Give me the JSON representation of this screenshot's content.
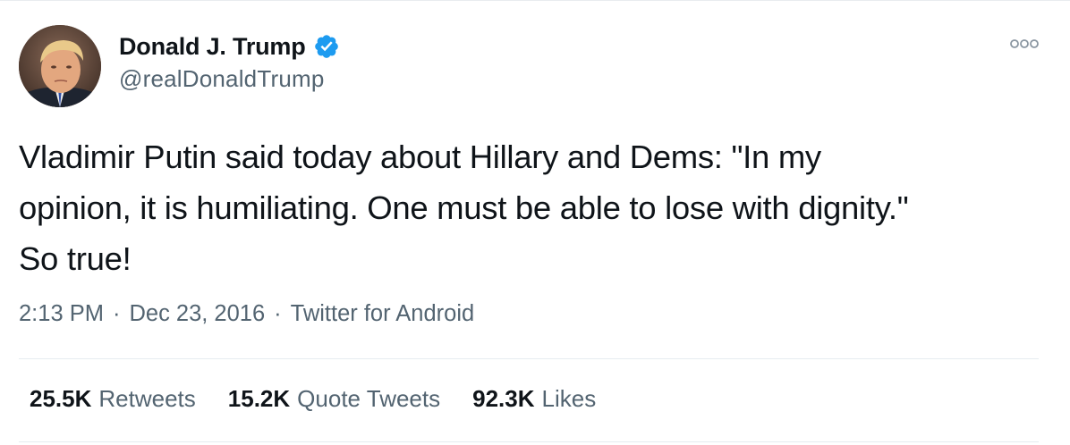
{
  "author": {
    "display_name": "Donald J. Trump",
    "handle": "@realDonaldTrump",
    "verified": true,
    "verified_color": "#1d9bf0"
  },
  "tweet": {
    "text": "Vladimir Putin said today about Hillary and Dems: \"In my\nopinion, it is humiliating. One must be able to lose with dignity.\"\nSo true!",
    "time": "2:13 PM",
    "date": "Dec 23, 2016",
    "source": "Twitter for Android",
    "separator": "·"
  },
  "stats": {
    "retweets": {
      "count": "25.5K",
      "label": "Retweets"
    },
    "quotes": {
      "count": "15.2K",
      "label": "Quote Tweets"
    },
    "likes": {
      "count": "92.3K",
      "label": "Likes"
    }
  },
  "icons": {
    "verified": "verified-badge-icon",
    "more": "more-options-icon"
  }
}
